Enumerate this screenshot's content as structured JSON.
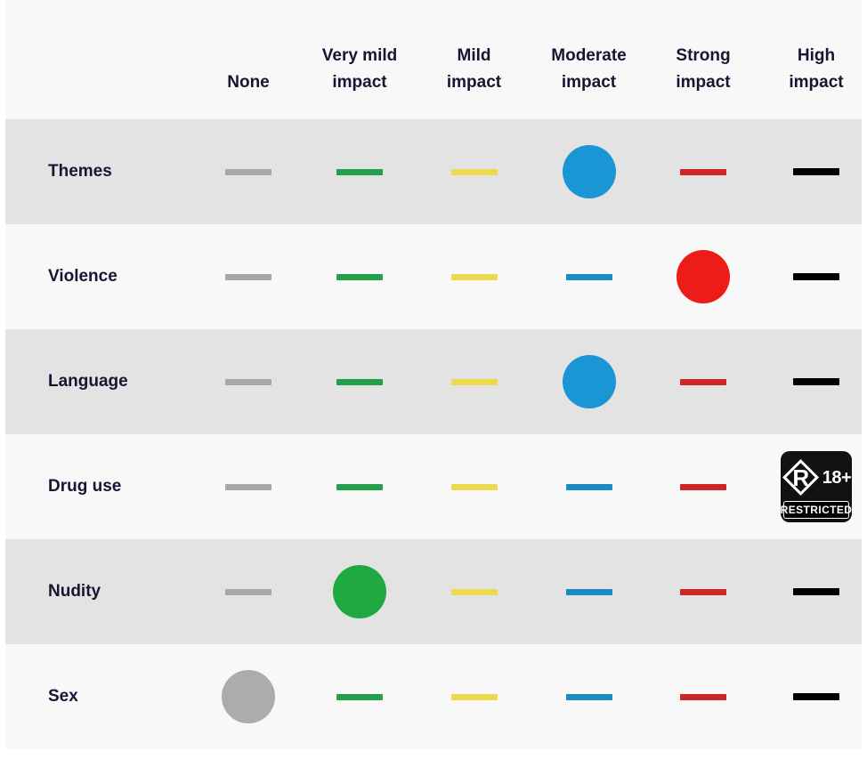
{
  "table": {
    "columns": [
      {
        "id": "label",
        "line1": "",
        "line2": ""
      },
      {
        "id": "none",
        "line1": "None",
        "line2": ""
      },
      {
        "id": "verymild",
        "line1": "Very mild",
        "line2": "impact"
      },
      {
        "id": "mild",
        "line1": "Mild",
        "line2": "impact"
      },
      {
        "id": "moderate",
        "line1": "Moderate",
        "line2": "impact"
      },
      {
        "id": "strong",
        "line1": "Strong",
        "line2": "impact"
      },
      {
        "id": "high",
        "line1": "High",
        "line2": "impact"
      }
    ],
    "rows": [
      {
        "label": "Themes",
        "selected": "moderate",
        "shade": "dark"
      },
      {
        "label": "Violence",
        "selected": "strong",
        "shade": "light"
      },
      {
        "label": "Language",
        "selected": "moderate",
        "shade": "dark"
      },
      {
        "label": "Drug use",
        "selected": "high",
        "shade": "light"
      },
      {
        "label": "Nudity",
        "selected": "verymild",
        "shade": "dark"
      },
      {
        "label": "Sex",
        "selected": "none",
        "shade": "light"
      }
    ],
    "badge": {
      "rating_letter": "R",
      "age": "18+",
      "banner": "RESTRICTED"
    },
    "colors": {
      "none": "#a7a7a7",
      "verymild": "#22a04a",
      "mild": "#ecd94d",
      "moderate": "#1a8cc4",
      "strong": "#ce2626",
      "high": "#000000",
      "dot_none": "#abacac",
      "dot_verymild": "#1eaa41",
      "dot_moderate": "#1b96d4",
      "dot_strong": "#ed1c18",
      "text": "#161632",
      "row_dark": "#e3e3e3",
      "row_light": "#f8f8f9",
      "page": "#ffffff"
    }
  }
}
